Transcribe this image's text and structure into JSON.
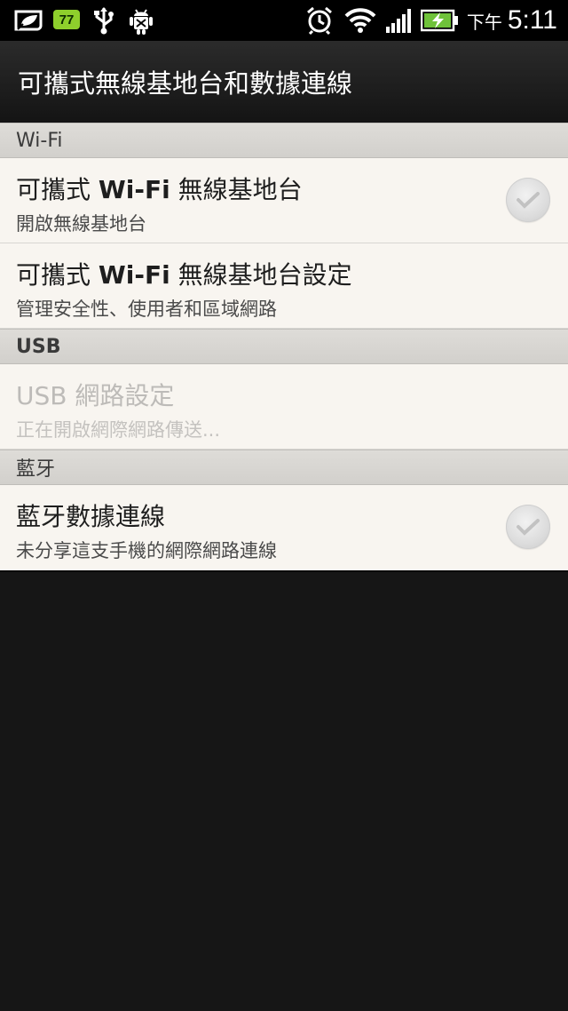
{
  "status_bar": {
    "battery_badge": "77",
    "ampm": "下午",
    "time": "5:11",
    "icons": [
      "leaf-icon",
      "usb-icon",
      "android-debug-icon",
      "alarm-icon",
      "wifi-icon",
      "signal-icon",
      "battery-charging-icon"
    ]
  },
  "title_bar": {
    "title": "可攜式無線基地台和數據連線"
  },
  "sections": [
    {
      "header": "Wi-Fi",
      "items": [
        {
          "title_prefix": "可攜式 ",
          "title_bold": "Wi-Fi",
          "title_suffix": " 無線基地台",
          "subtitle": "開啟無線基地台",
          "checkbox": true,
          "checked": false
        },
        {
          "title_prefix": "可攜式 ",
          "title_bold": "Wi-Fi",
          "title_suffix": " 無線基地台設定",
          "subtitle": "管理安全性、使用者和區域網路",
          "checkbox": false
        }
      ]
    },
    {
      "header": "USB",
      "items": [
        {
          "title": "USB 網路設定",
          "subtitle": "正在開啟網際網路傳送...",
          "disabled": true,
          "checkbox": false
        }
      ]
    },
    {
      "header": "藍牙",
      "items": [
        {
          "title": "藍牙數據連線",
          "subtitle": "未分享這支手機的網際網路連線",
          "checkbox": true,
          "checked": false
        }
      ]
    }
  ],
  "colors": {
    "status_bar_bg": "#000000",
    "title_bar_bg": "#1c1c1c",
    "list_bg": "#f8f5f0",
    "section_header_bg": "#d6d4d0",
    "screen_bg": "#161616",
    "battery_badge": "#8ecf2c"
  }
}
